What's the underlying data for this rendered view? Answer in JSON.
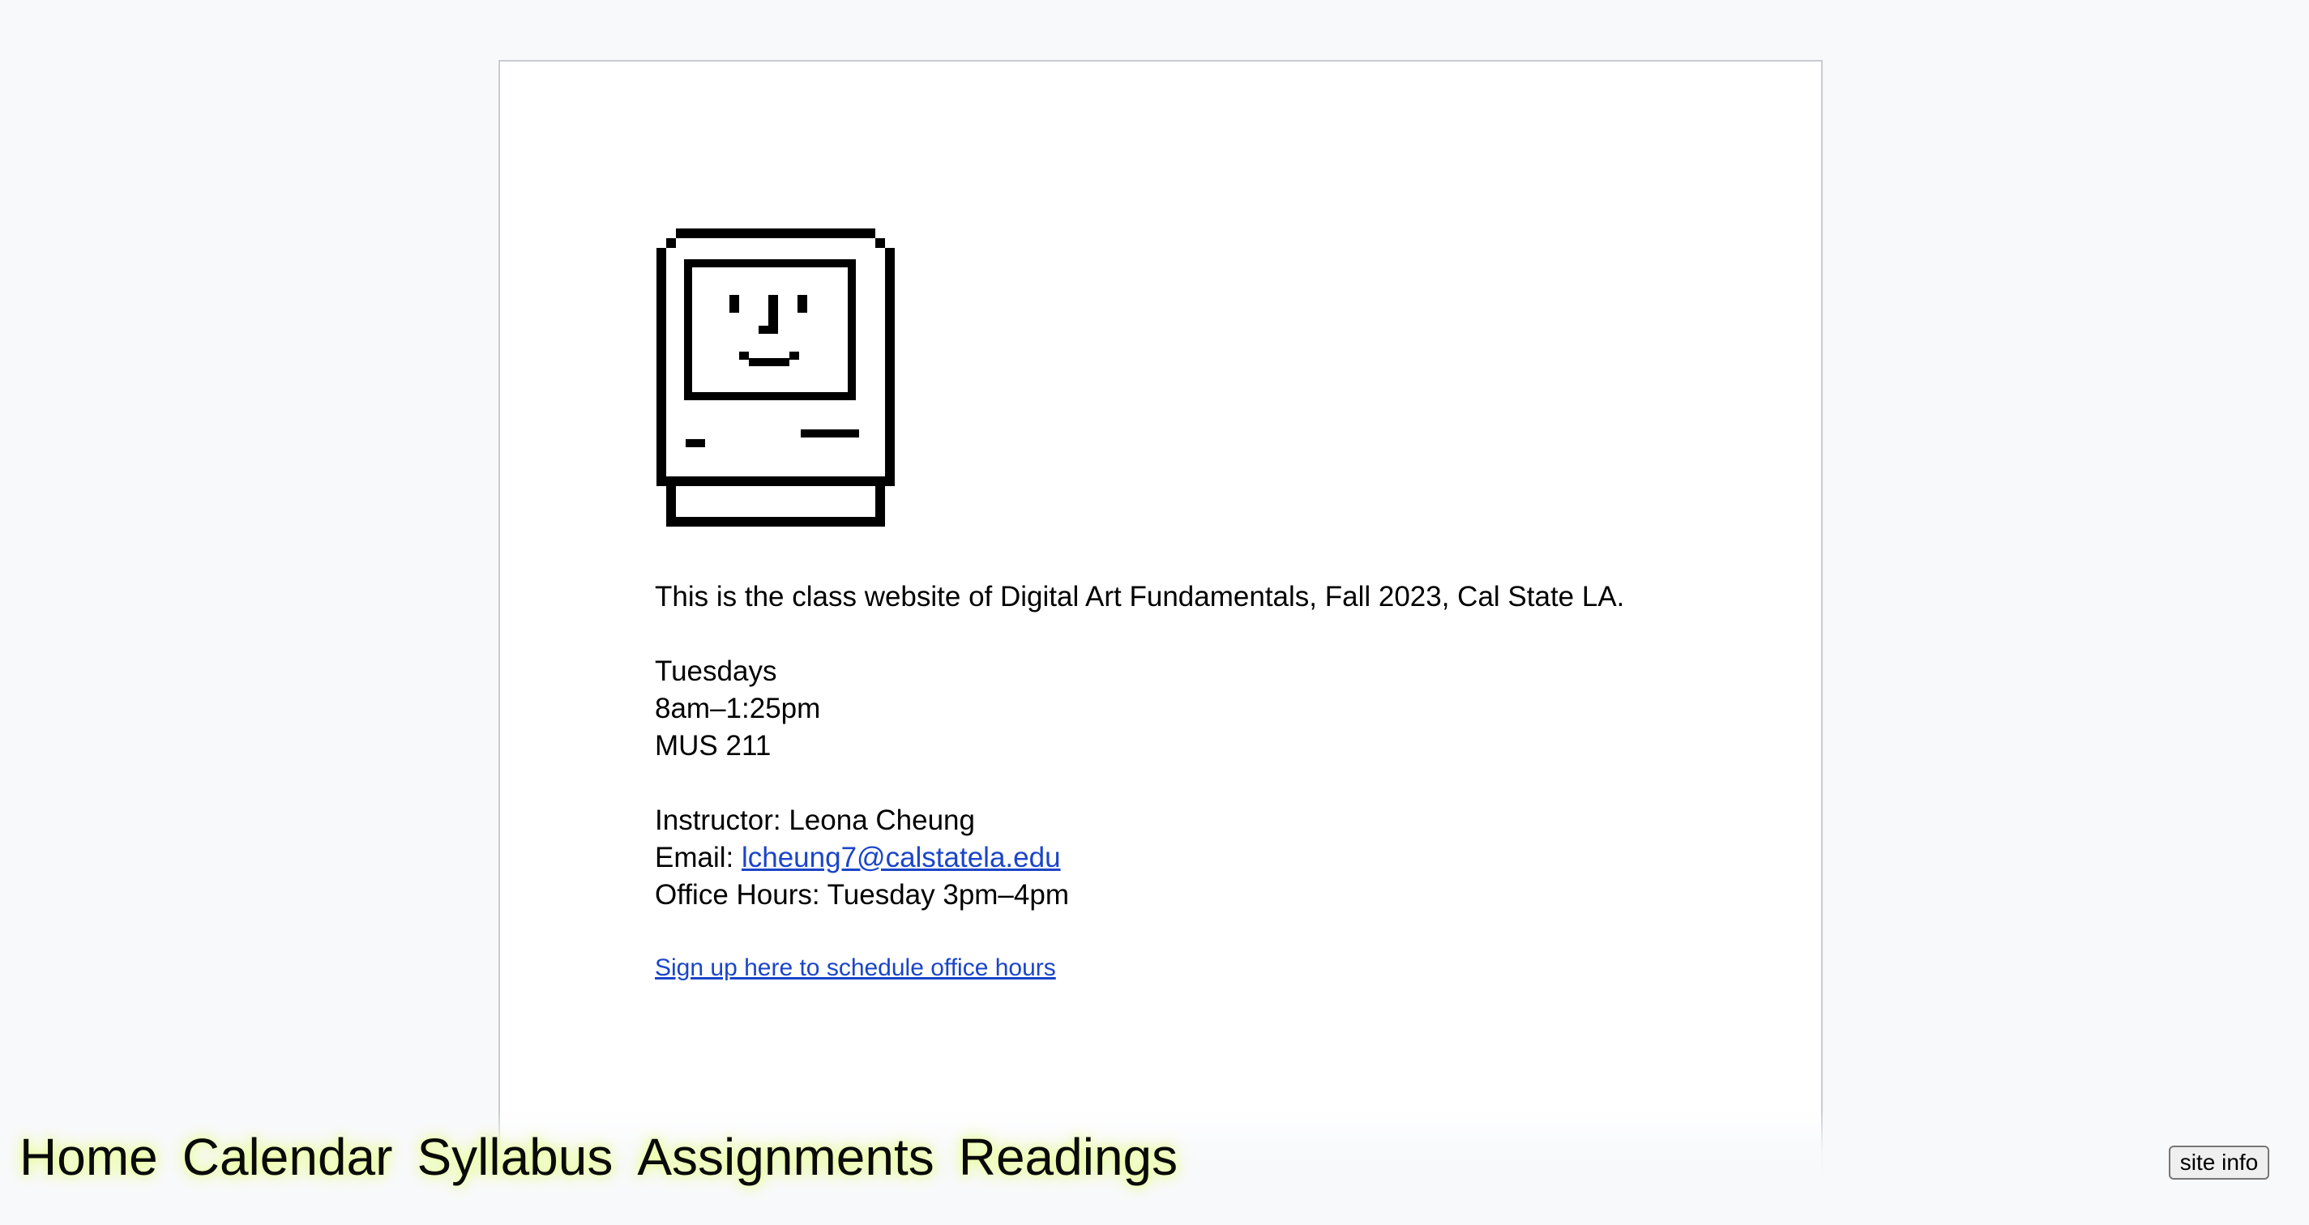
{
  "intro": {
    "text": "This is the class website of Digital Art Fundamentals, Fall 2023, Cal State LA."
  },
  "schedule": {
    "day": "Tuesdays",
    "time": "8am–1:25pm",
    "room": "MUS 211"
  },
  "instructor": {
    "name_line": "Instructor: Leona Cheung",
    "email_label": "Email: ",
    "email": "lcheung7@calstatela.edu",
    "office_hours": "Office Hours: Tuesday 3pm–4pm"
  },
  "signup": {
    "label": "Sign up here to schedule office hours"
  },
  "nav": {
    "items": [
      {
        "label": "Home"
      },
      {
        "label": "Calendar"
      },
      {
        "label": "Syllabus"
      },
      {
        "label": "Assignments"
      },
      {
        "label": "Readings"
      }
    ],
    "glow_color": "#e8ff99"
  },
  "site_info": {
    "label": "site info"
  },
  "colors": {
    "link": "#1a45c8",
    "background": "#f8f9fb",
    "card": "#ffffff"
  },
  "icons": {
    "logo": "happy-mac-icon"
  }
}
